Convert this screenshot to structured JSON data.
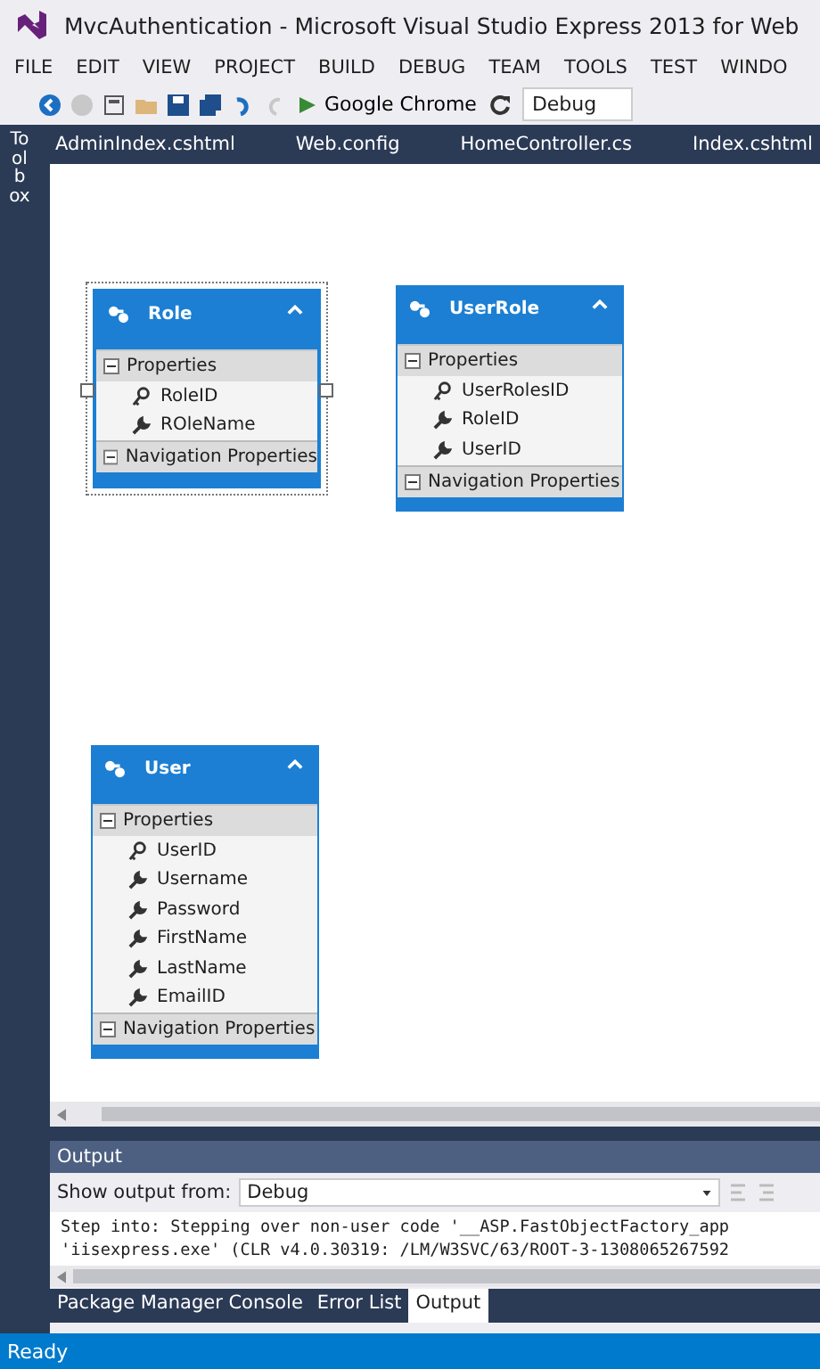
{
  "window": {
    "title": "MvcAuthentication - Microsoft Visual Studio Express 2013 for Web"
  },
  "menu": [
    "FILE",
    "EDIT",
    "VIEW",
    "PROJECT",
    "BUILD",
    "DEBUG",
    "TEAM",
    "TOOLS",
    "TEST",
    "WINDO"
  ],
  "toolbar": {
    "run_target": "Google Chrome",
    "configuration": "Debug"
  },
  "toolbox": {
    "label": "Toolbox"
  },
  "document_tabs": [
    "AdminIndex.cshtml",
    "Web.config",
    "HomeController.cs",
    "Index.cshtml"
  ],
  "entities": [
    {
      "name": "Role",
      "selected": true,
      "section": "Properties",
      "navigation": "Navigation Properties",
      "properties": [
        {
          "name": "RoleID",
          "kind": "key"
        },
        {
          "name": "ROleName",
          "kind": "scalar"
        }
      ]
    },
    {
      "name": "UserRole",
      "selected": false,
      "section": "Properties",
      "navigation": "Navigation Properties",
      "properties": [
        {
          "name": "UserRolesID",
          "kind": "key"
        },
        {
          "name": "RoleID",
          "kind": "scalar"
        },
        {
          "name": "UserID",
          "kind": "scalar"
        }
      ]
    },
    {
      "name": "User",
      "selected": false,
      "section": "Properties",
      "navigation": "Navigation Properties",
      "properties": [
        {
          "name": "UserID",
          "kind": "key"
        },
        {
          "name": "Username",
          "kind": "scalar"
        },
        {
          "name": "Password",
          "kind": "scalar"
        },
        {
          "name": "FirstName",
          "kind": "scalar"
        },
        {
          "name": "LastName",
          "kind": "scalar"
        },
        {
          "name": "EmailID",
          "kind": "scalar"
        }
      ]
    }
  ],
  "output": {
    "title": "Output",
    "source_label": "Show output from:",
    "source": "Debug",
    "lines": [
      "Step into: Stepping over non-user code '__ASP.FastObjectFactory_app",
      "'iisexpress.exe' (CLR v4.0.30319: /LM/W3SVC/63/ROOT-3-1308065267592"
    ]
  },
  "bottom_tabs": [
    {
      "label": "Package Manager Console",
      "selected": false
    },
    {
      "label": "Error List",
      "selected": false
    },
    {
      "label": "Output",
      "selected": true
    }
  ],
  "status_bar": {
    "text": "Ready"
  }
}
